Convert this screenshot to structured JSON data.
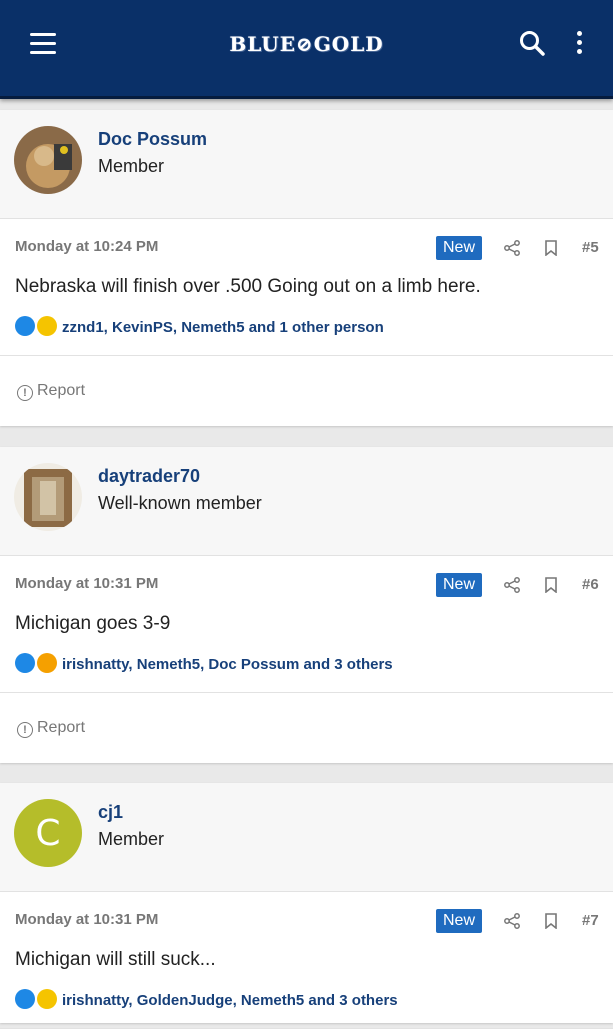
{
  "header": {
    "logo_text": "BLUE⊘GOLD",
    "menu_icon": "hamburger-icon",
    "search_icon": "search-icon",
    "more_icon": "kebab-menu-icon",
    "background_color": "#0a3068"
  },
  "posts": [
    {
      "username": "Doc Possum",
      "user_title": "Member",
      "date": "Monday at 10:24 PM",
      "badge": "New",
      "post_number": "#5",
      "message": "Nebraska will finish over .500 Going out on a limb here.",
      "reactions": [
        "like",
        "laugh"
      ],
      "reaction_users": "zznd1, KevinPS, Nemeth5 and 1 other person",
      "report_label": "Report"
    },
    {
      "username": "daytrader70",
      "user_title": "Well-known member",
      "date": "Monday at 10:31 PM",
      "badge": "New",
      "post_number": "#6",
      "message": "Michigan goes 3-9",
      "reactions": [
        "like",
        "love"
      ],
      "reaction_users": "irishnatty, Nemeth5, Doc Possum and 3 others",
      "report_label": "Report"
    },
    {
      "username": "cj1",
      "user_title": "Member",
      "avatar_letter": "C",
      "avatar_color": "#b5bd2a",
      "date": "Monday at 10:31 PM",
      "badge": "New",
      "post_number": "#7",
      "message": "Michigan will still suck...",
      "reactions": [
        "like",
        "laugh"
      ],
      "reaction_users": "irishnatty, GoldenJudge, Nemeth5 and 3 others"
    }
  ]
}
